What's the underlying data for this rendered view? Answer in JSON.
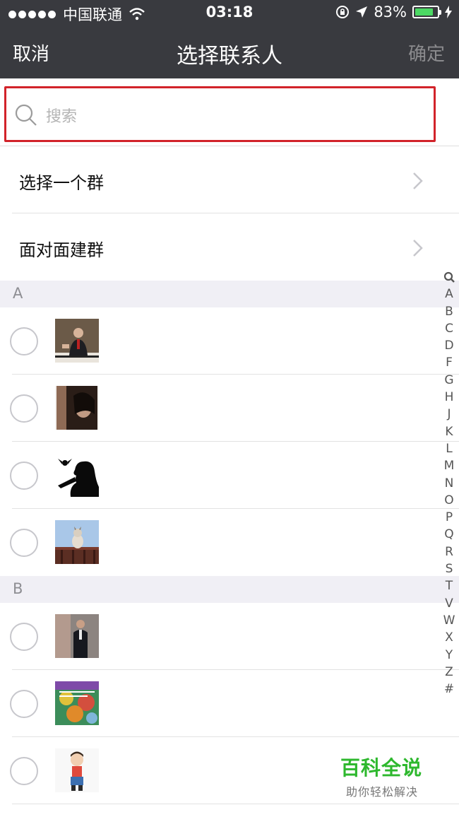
{
  "status_bar": {
    "carrier": "中国联通",
    "time": "03:18",
    "battery": "83%",
    "battery_level": 0.83
  },
  "nav": {
    "cancel_label": "取消",
    "title": "选择联系人",
    "confirm_label": "确定"
  },
  "search": {
    "placeholder": "搜索"
  },
  "menu": [
    {
      "label": "选择一个群"
    },
    {
      "label": "面对面建群"
    }
  ],
  "sections": [
    {
      "letter": "A"
    },
    {
      "letter": "B"
    }
  ],
  "index_letters": [
    "A",
    "B",
    "C",
    "D",
    "F",
    "G",
    "H",
    "J",
    "K",
    "L",
    "M",
    "N",
    "O",
    "P",
    "Q",
    "R",
    "S",
    "T",
    "V",
    "W",
    "X",
    "Y",
    "Z",
    "#"
  ],
  "watermark": {
    "title": "百科全说",
    "subtitle": "助你轻松解决"
  },
  "colors": {
    "nav_bg": "#393a3f",
    "highlight_border": "#d2232a",
    "battery": "#4cd964",
    "watermark": "#2eb82e"
  }
}
